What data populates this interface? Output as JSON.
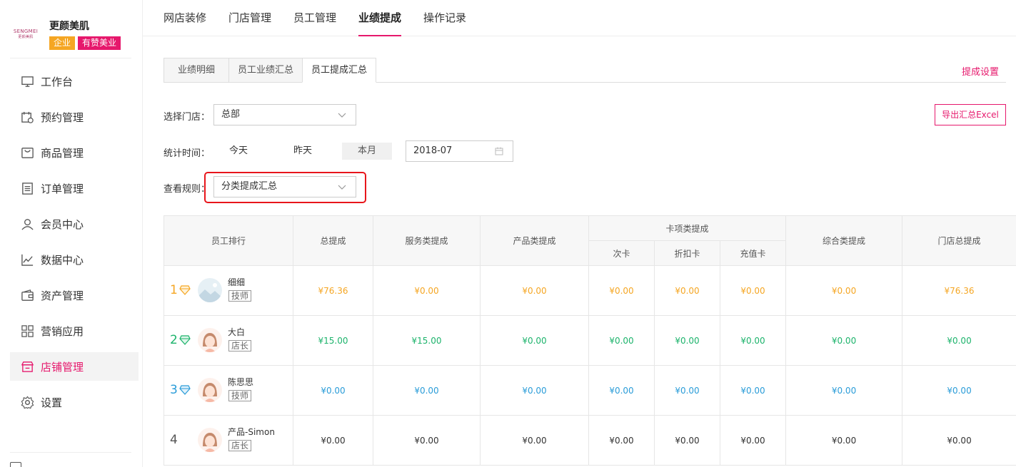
{
  "brand": {
    "logo_text": "SENGMEI",
    "logo_sub": "更颜美肌",
    "name": "更颜美肌",
    "tag_enterprise": "企业",
    "tag_app": "有赞美业"
  },
  "sidebar": {
    "items": [
      {
        "label": "工作台",
        "icon": "monitor-icon"
      },
      {
        "label": "预约管理",
        "icon": "calendar-clock-icon"
      },
      {
        "label": "商品管理",
        "icon": "bag-icon"
      },
      {
        "label": "订单管理",
        "icon": "list-doc-icon"
      },
      {
        "label": "会员中心",
        "icon": "user-icon"
      },
      {
        "label": "数据中心",
        "icon": "chart-line-icon"
      },
      {
        "label": "资产管理",
        "icon": "wallet-icon"
      },
      {
        "label": "营销应用",
        "icon": "grid-apps-icon"
      },
      {
        "label": "店铺管理",
        "icon": "store-icon",
        "active": true
      },
      {
        "label": "设置",
        "icon": "gear-icon"
      }
    ]
  },
  "topnav": {
    "tabs": [
      "网店装修",
      "门店管理",
      "员工管理",
      "业绩提成",
      "操作记录"
    ],
    "active": "业绩提成"
  },
  "subtabs": {
    "tabs": [
      "业绩明细",
      "员工业绩汇总",
      "员工提成汇总"
    ],
    "active": "员工提成汇总",
    "settings_link": "提成设置"
  },
  "filters": {
    "store_label": "选择门店：",
    "store_value": "总部",
    "time_label": "统计时间：",
    "time_options": [
      "今天",
      "昨天",
      "本月"
    ],
    "time_active": "本月",
    "month_value": "2018-07",
    "rule_label": "查看规则：",
    "rule_value": "分类提成汇总",
    "export_label": "导出汇总Excel"
  },
  "table": {
    "headers": {
      "employee_rank": "员工排行",
      "total": "总提成",
      "service": "服务类提成",
      "product": "产品类提成",
      "card_group": "卡项类提成",
      "card_times": "次卡",
      "card_discount": "折扣卡",
      "card_recharge": "充值卡",
      "comprehensive": "综合类提成",
      "store_total": "门店总提成"
    },
    "rows": [
      {
        "rank": "1",
        "name": "细细",
        "role": "技师",
        "gem": "gold",
        "values": [
          "¥76.36",
          "¥0.00",
          "¥0.00",
          "¥0.00",
          "¥0.00",
          "¥0.00",
          "¥0.00",
          "¥76.36"
        ]
      },
      {
        "rank": "2",
        "name": "大白",
        "role": "店长",
        "gem": "green",
        "values": [
          "¥15.00",
          "¥15.00",
          "¥0.00",
          "¥0.00",
          "¥0.00",
          "¥0.00",
          "¥0.00",
          "¥0.00"
        ]
      },
      {
        "rank": "3",
        "name": "陈思思",
        "role": "技师",
        "gem": "blue",
        "values": [
          "¥0.00",
          "¥0.00",
          "¥0.00",
          "¥0.00",
          "¥0.00",
          "¥0.00",
          "¥0.00",
          "¥0.00"
        ]
      },
      {
        "rank": "4",
        "name": "产品-Simon",
        "role": "店长",
        "gem": "none",
        "values": [
          "¥0.00",
          "¥0.00",
          "¥0.00",
          "¥0.00",
          "¥0.00",
          "¥0.00",
          "¥0.00",
          "¥0.00"
        ]
      }
    ]
  },
  "colors": {
    "accent": "#e6186c",
    "gold": "#f5a623",
    "green": "#1cb36b",
    "blue": "#2a9cd8",
    "highlight": "#e8151b"
  }
}
